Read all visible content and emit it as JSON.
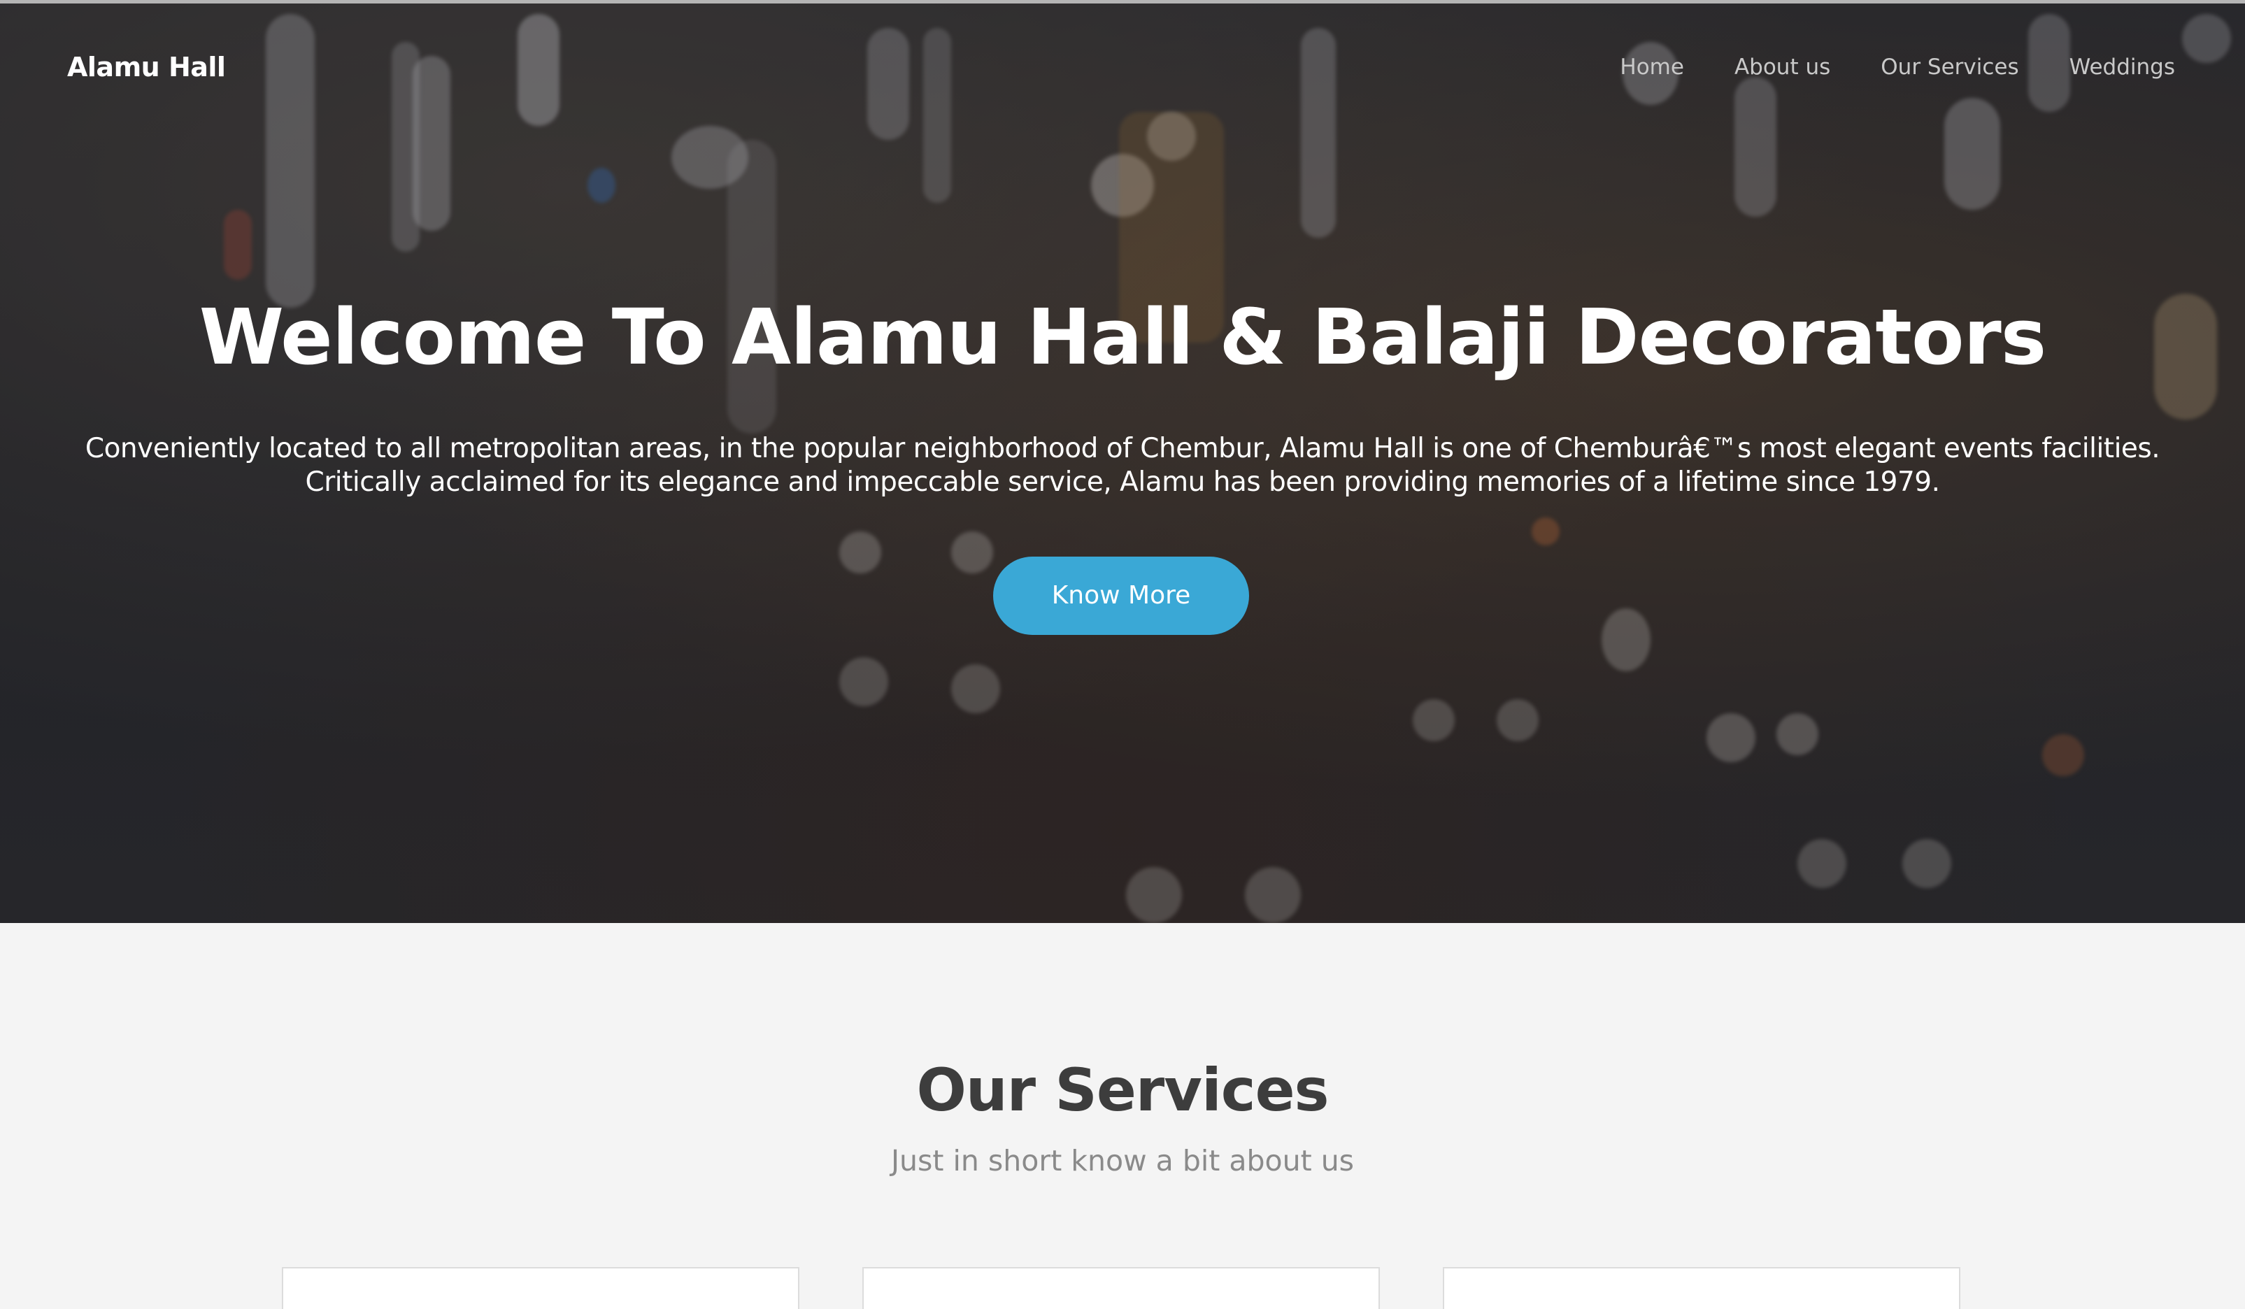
{
  "navbar": {
    "brand": "Alamu Hall",
    "links": [
      {
        "label": "Home"
      },
      {
        "label": "About us"
      },
      {
        "label": "Our Services"
      },
      {
        "label": "Weddings"
      }
    ]
  },
  "hero": {
    "title": "Welcome To Alamu Hall & Balaji Decorators",
    "subtitle_line1": "Conveniently located to all metropolitan areas, in the popular neighborhood of Chembur, Alamu Hall is one of Chemburâ€™s most elegant events facilities.",
    "subtitle_line2": "Critically acclaimed for its elegance and impeccable service, Alamu has been providing memories of a lifetime since 1979.",
    "cta_label": "Know More",
    "cta_color": "#3aa8d6"
  },
  "services": {
    "title": "Our Services",
    "subtitle": "Just in short know a bit about us"
  },
  "colors": {
    "hero_background": "#26272c",
    "section_background": "#f4f4f4",
    "heading_dark": "#3d3d3d"
  }
}
